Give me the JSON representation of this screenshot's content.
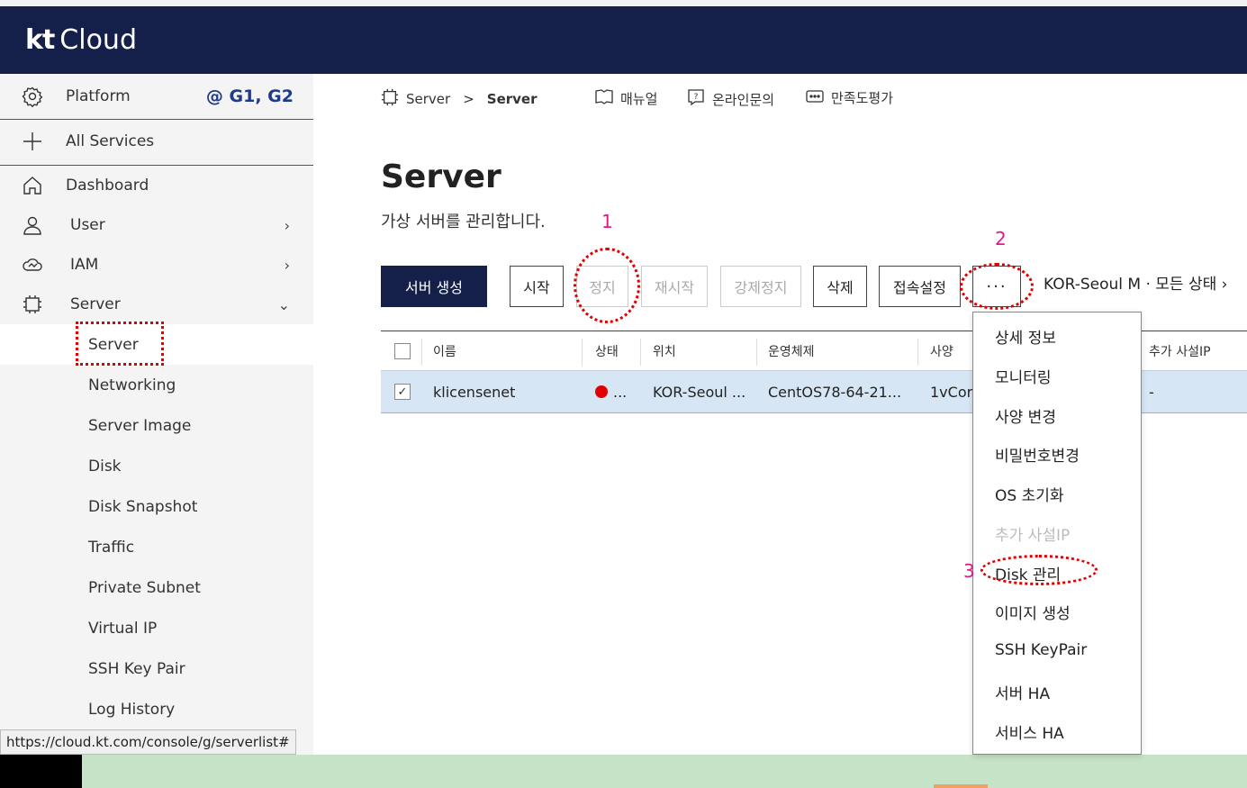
{
  "header": {
    "logo_kt": "kt",
    "logo_cloud": "Cloud"
  },
  "sidebar": {
    "platform_label": "Platform",
    "platform_badge": "@ G1, G2",
    "all_services": "All Services",
    "dashboard": "Dashboard",
    "user": "User",
    "iam": "IAM",
    "server": "Server",
    "sub_items": [
      "Server",
      "Networking",
      "Server Image",
      "Disk",
      "Disk Snapshot",
      "Traffic",
      "Private Subnet",
      "Virtual IP",
      "SSH Key Pair",
      "Log History"
    ]
  },
  "status_url": "https://cloud.kt.com/console/g/serverlist#",
  "breadcrumb": {
    "root": "Server",
    "sep": ">",
    "current": "Server"
  },
  "links": {
    "manual": "매뉴얼",
    "inquiry": "온라인문의",
    "survey": "만족도평가"
  },
  "page": {
    "title": "Server",
    "description": "가상 서버를 관리합니다."
  },
  "buttons": {
    "create": "서버 생성",
    "start": "시작",
    "stop": "정지",
    "restart": "재시작",
    "force_stop": "강제정지",
    "delete": "삭제",
    "access": "접속설정",
    "more": "···"
  },
  "region_filter": "KOR-Seoul M · 모든 상태 ›",
  "table": {
    "headers": [
      "이름",
      "상태",
      "위치",
      "운영체제",
      "사양",
      "추가 사설IP"
    ],
    "row": {
      "name": "klicensenet",
      "status_text": "...",
      "location": "KOR-Seoul ...",
      "os": "CentOS78-64-21...",
      "spec": "1vCor",
      "extra_ip": "-"
    }
  },
  "more_menu": [
    {
      "label": "상세 정보",
      "disabled": false
    },
    {
      "label": "모니터링",
      "disabled": false
    },
    {
      "label": "사양 변경",
      "disabled": false
    },
    {
      "label": "비밀번호변경",
      "disabled": false
    },
    {
      "label": "OS 초기화",
      "disabled": false
    },
    {
      "label": "추가 사설IP",
      "disabled": true
    },
    {
      "label": "Disk 관리",
      "disabled": false
    },
    {
      "label": "이미지 생성",
      "disabled": false
    },
    {
      "label": "SSH KeyPair",
      "disabled": false
    },
    {
      "label": "서버 HA",
      "disabled": false
    },
    {
      "label": "서비스 HA",
      "disabled": false
    }
  ],
  "annotations": {
    "n1": "1",
    "n2": "2",
    "n3": "3"
  },
  "colors": {
    "header_bg": "#14204a",
    "accent": "#1e3a8a",
    "annotation": "#e00000",
    "annotation_number": "#e0198a",
    "status_red": "#e00000"
  }
}
